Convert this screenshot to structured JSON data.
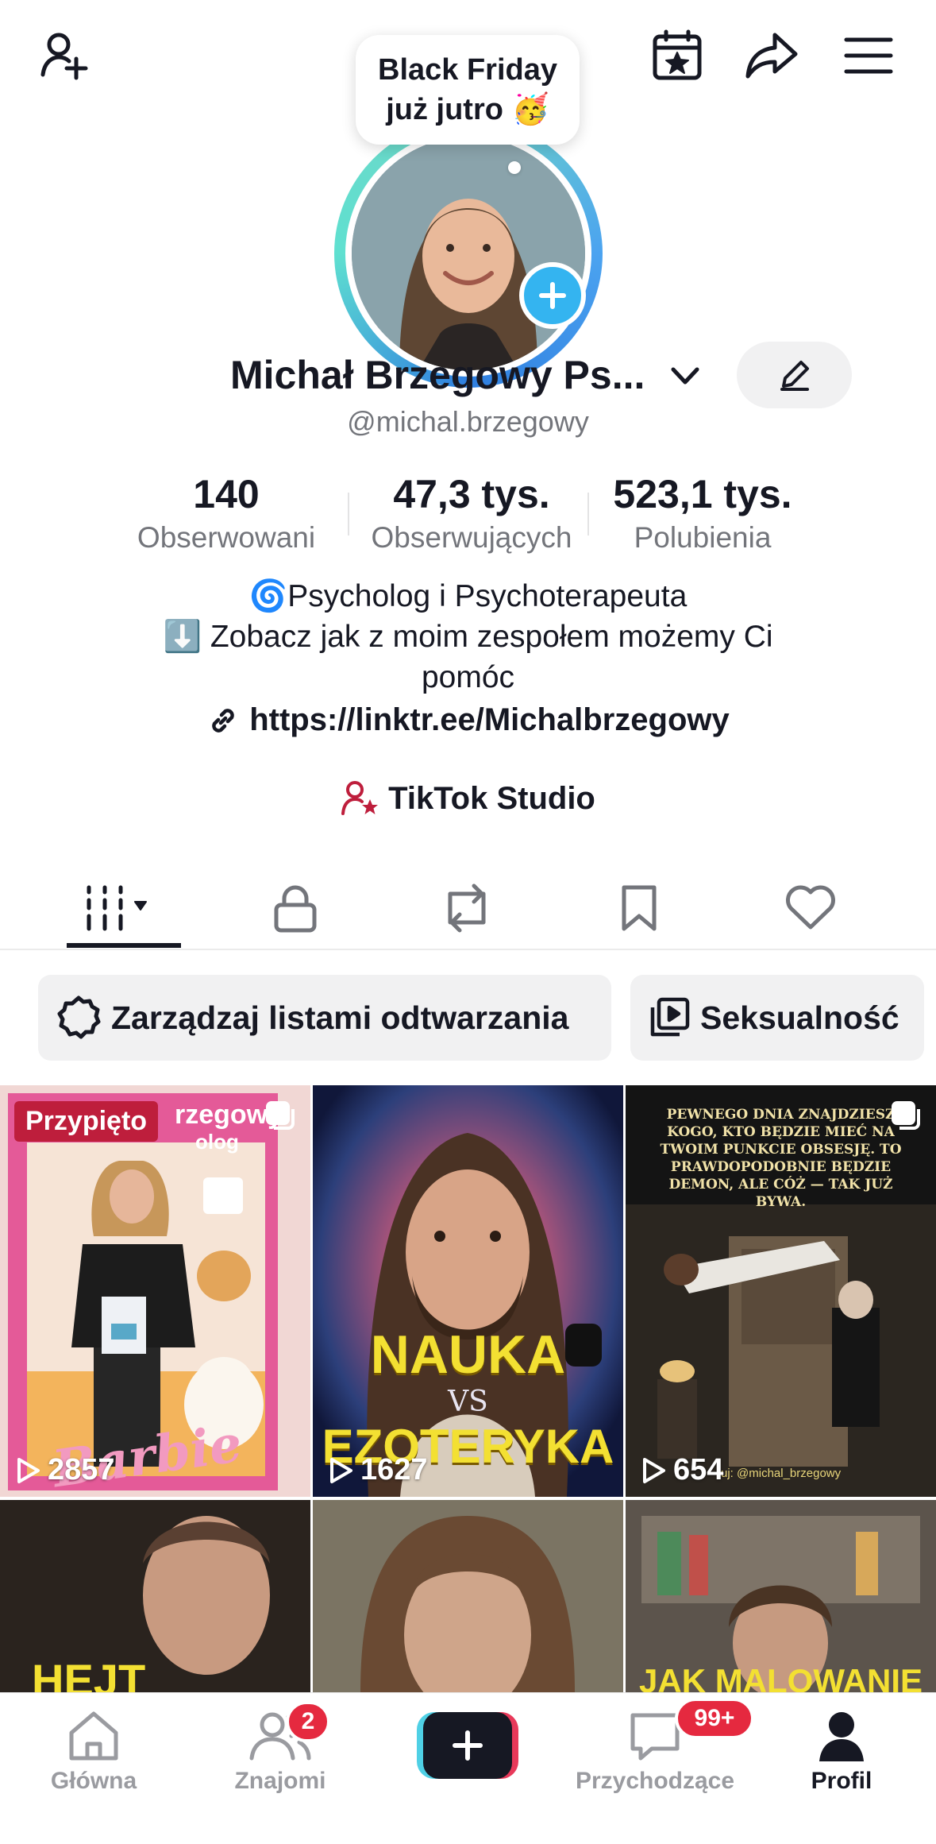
{
  "header": {
    "add_friend_icon": "person-plus-icon",
    "calendar_icon": "calendar-star-icon",
    "share_icon": "share-arrow-icon",
    "menu_icon": "hamburger-menu-icon"
  },
  "bubble": {
    "line1": "Black Friday",
    "line2": "już jutro 🥳"
  },
  "profile": {
    "name": "Michał Brzegowy Ps...",
    "handle": "@michal.brzegowy"
  },
  "stats": [
    {
      "value": "140",
      "label": "Obserwowani"
    },
    {
      "value": "47,3 tys.",
      "label": "Obserwujących"
    },
    {
      "value": "523,1 tys.",
      "label": "Polubienia"
    }
  ],
  "bio": {
    "line1": "🌀Psycholog i Psychoterapeuta",
    "line2": "⬇️ Zobacz jak z moim zespołem możemy Ci",
    "line3": "pomóc",
    "link": "https://linktr.ee/Michalbrzegowy"
  },
  "studio": {
    "label": "TikTok Studio"
  },
  "chips": {
    "playlists": "Zarządzaj listami odtwarzania",
    "playlist_name": "Seksualność"
  },
  "videos": [
    {
      "views": "2857",
      "pinned_label": "Przypięto",
      "title_overlay": "rzegowy",
      "subtitle_overlay": "olog",
      "brand": "Barbie"
    },
    {
      "views": "1627",
      "title_top": "NAUKA",
      "title_mid": "VS",
      "title_bottom": "EZOTERYKA"
    },
    {
      "views": "654",
      "caption": "PEWNEGO DNIA ZNAJDZIESZ KOGO, KTO BĘDZIE MIEĆ NA TWOIM PUNKCIE OBSESJĘ. TO PRAWDOPODOBNIE BĘDZIE DEMON, ALE CÓŻ — TAK JUŻ BYWA.",
      "watermark": "uj: @michal_brzegowy"
    },
    {
      "title_overlay": "HEJT AKTORA"
    },
    {},
    {
      "title_overlay": "JAK MALOWANIE"
    }
  ],
  "nav": {
    "home": "Główna",
    "friends": "Znajomi",
    "friends_badge": "2",
    "inbox": "Przychodzące",
    "inbox_badge": "99+",
    "profile": "Profil"
  }
}
